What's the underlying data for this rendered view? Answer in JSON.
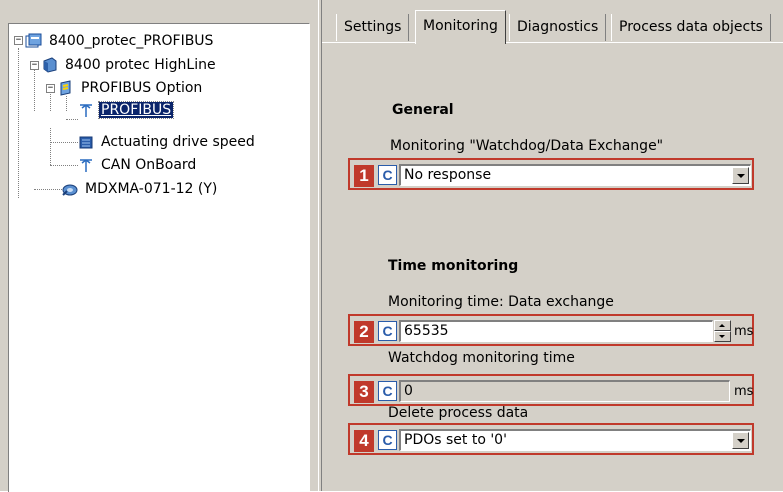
{
  "tree": {
    "nodes": [
      {
        "label": "8400_protec_PROFIBUS",
        "icon": "project-icon",
        "expander": "−"
      },
      {
        "label": "8400 protec HighLine",
        "icon": "device-icon",
        "expander": "−"
      },
      {
        "label": "PROFIBUS Option",
        "icon": "option-module-icon",
        "expander": "−"
      },
      {
        "label": "PROFIBUS",
        "icon": "bus-antenna-icon",
        "selected": true
      },
      {
        "label": "Actuating drive speed",
        "icon": "application-icon"
      },
      {
        "label": "CAN OnBoard",
        "icon": "bus-antenna-icon"
      },
      {
        "label": "MDXMA-071-12 (Y)",
        "icon": "motor-icon"
      }
    ]
  },
  "tabs": [
    "Settings",
    "Monitoring",
    "Diagnostics",
    "Process data objects"
  ],
  "active_tab": "Monitoring",
  "general": {
    "title": "General",
    "watchdog_label": "Monitoring \"Watchdog/Data Exchange\"",
    "watchdog_value": "No response"
  },
  "time_monitoring": {
    "title": "Time monitoring",
    "data_exchange_label": "Monitoring time: Data exchange",
    "data_exchange_value": "65535",
    "watchdog_time_label": "Watchdog monitoring time",
    "watchdog_time_value": "0",
    "delete_label": "Delete process data",
    "delete_value": "PDOs set to '0'",
    "unit": "ms"
  },
  "callouts": [
    "1",
    "2",
    "3",
    "4"
  ],
  "c_button_label": "C",
  "colors": {
    "callout": "#c0392b",
    "selection": "#0a246a",
    "c_button": "#2a5caa"
  }
}
